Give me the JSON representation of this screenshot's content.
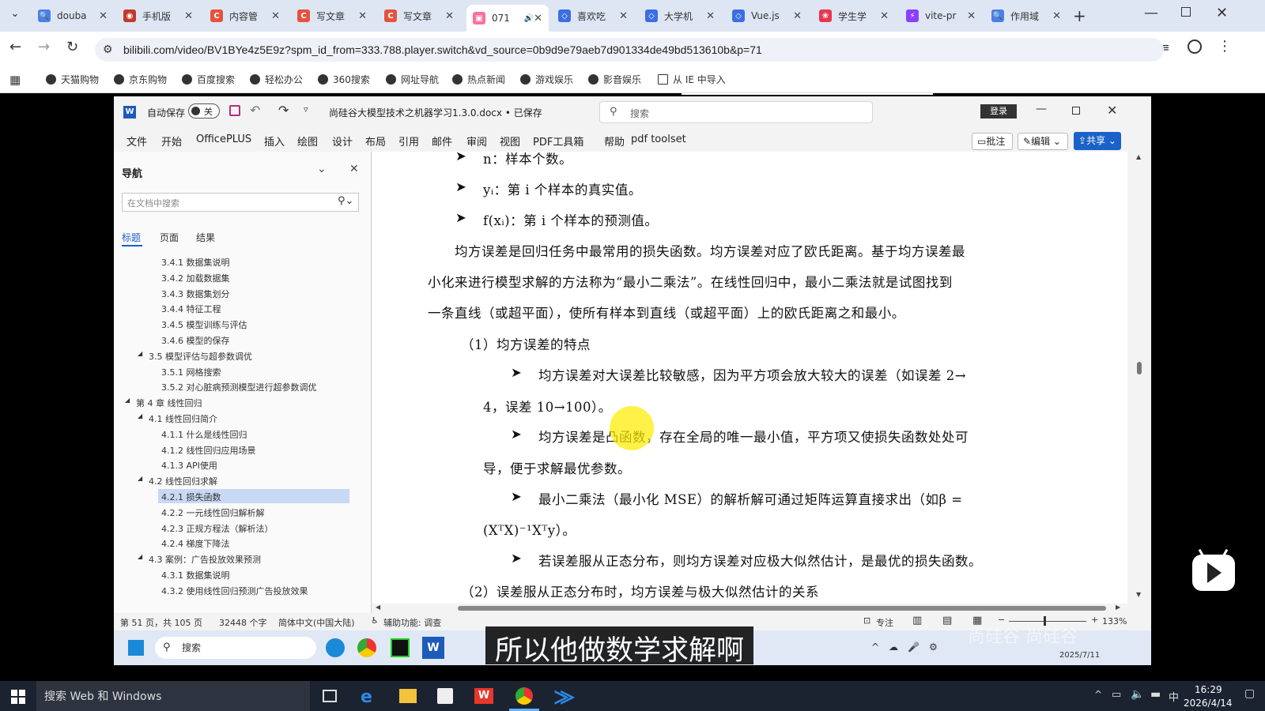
{
  "browser": {
    "tabs": [
      {
        "label": "douba",
        "color": "#4a7fe8",
        "glyph": "🔍",
        "icon": "search-icon"
      },
      {
        "label": "手机版",
        "color": "#c0392b",
        "glyph": "◉",
        "icon": "avatar-icon"
      },
      {
        "label": "内容管",
        "color": "#e5533d",
        "glyph": "C",
        "icon": "csdn-icon"
      },
      {
        "label": "写文章",
        "color": "#e5533d",
        "glyph": "C",
        "icon": "csdn-icon"
      },
      {
        "label": "写文章",
        "color": "#e5533d",
        "glyph": "C",
        "icon": "csdn-icon"
      },
      {
        "label": "071",
        "color": "#fb7299",
        "glyph": "▣",
        "icon": "bilibili-icon",
        "active": true
      },
      {
        "label": "喜欢吃",
        "color": "#3b6fe0",
        "glyph": "◇",
        "icon": "diamond-icon"
      },
      {
        "label": "大学机",
        "color": "#3b6fe0",
        "glyph": "◇",
        "icon": "diamond-icon"
      },
      {
        "label": "Vue.js",
        "color": "#3b6fe0",
        "glyph": "◇",
        "icon": "diamond-icon"
      },
      {
        "label": "学生学",
        "color": "#e63950",
        "glyph": "❀",
        "icon": "flower-icon"
      },
      {
        "label": "vite-pr",
        "color": "#8a3ffc",
        "glyph": "⚡",
        "icon": "vite-icon"
      },
      {
        "label": "作用域",
        "color": "#4a7fe8",
        "glyph": "🔍",
        "icon": "search-icon"
      }
    ],
    "url": "bilibili.com/video/BV1BYe4z5E9z?spm_id_from=333.788.player.switch&vd_source=0b9d9e79aeb7d901334de49bd513610b&p=71",
    "bookmarks": [
      "天猫购物",
      "京东购物",
      "百度搜索",
      "轻松办公",
      "360搜索",
      "网址导航",
      "热点新闻",
      "游戏娱乐",
      "影音娱乐",
      "从 IE 中导入"
    ]
  },
  "word": {
    "autosave_label": "自动保存",
    "autosave_state": "关",
    "doc_title": "尚硅谷大模型技术之机器学习1.3.0.docx • 已保存",
    "search_placeholder": "搜索",
    "login_label": "登录",
    "menu": [
      "文件",
      "开始",
      "OfficePLUS",
      "插入",
      "绘图",
      "设计",
      "布局",
      "引用",
      "邮件",
      "审阅",
      "视图",
      "PDF工具箱",
      "帮助",
      "pdf toolset"
    ],
    "comment_label": "批注",
    "edit_label": "编辑",
    "share_label": "共享",
    "nav": {
      "title": "导航",
      "search_placeholder": "在文档中搜索",
      "tabs": [
        "标题",
        "页面",
        "结果"
      ],
      "items": [
        {
          "text": "3.4.1 数据集说明",
          "level": 3
        },
        {
          "text": "3.4.2 加载数据集",
          "level": 3
        },
        {
          "text": "3.4.3 数据集划分",
          "level": 3
        },
        {
          "text": "3.4.4 特征工程",
          "level": 3
        },
        {
          "text": "3.4.5 模型训练与评估",
          "level": 3
        },
        {
          "text": "3.4.6 模型的保存",
          "level": 3
        },
        {
          "text": "3.5 模型评估与超参数调优",
          "level": 2
        },
        {
          "text": "3.5.1 网格搜索",
          "level": 3
        },
        {
          "text": "3.5.2 对心脏病预测模型进行超参数调优",
          "level": 3
        },
        {
          "text": "第 4 章 线性回归",
          "level": 1
        },
        {
          "text": "4.1 线性回归简介",
          "level": 2
        },
        {
          "text": "4.1.1 什么是线性回归",
          "level": 3
        },
        {
          "text": "4.1.2 线性回归应用场景",
          "level": 3
        },
        {
          "text": "4.1.3 API使用",
          "level": 3
        },
        {
          "text": "4.2 线性回归求解",
          "level": 2
        },
        {
          "text": "4.2.1 损失函数",
          "level": 3,
          "selected": true
        },
        {
          "text": "4.2.2 一元线性回归解析解",
          "level": 3
        },
        {
          "text": "4.2.3 正规方程法（解析法）",
          "level": 3
        },
        {
          "text": "4.2.4 梯度下降法",
          "level": 3
        },
        {
          "text": "4.3 案例：广告投放效果预测",
          "level": 2
        },
        {
          "text": "4.3.1 数据集说明",
          "level": 3
        },
        {
          "text": "4.3.2 使用线性回归预测广告投放效果",
          "level": 3
        }
      ]
    },
    "doc_lines": [
      "n：样本个数。",
      "yᵢ：第 i 个样本的真实值。",
      "f(xᵢ)：第 i 个样本的预测值。",
      "均方误差是回归任务中最常用的损失函数。均方误差对应了欧氏距离。基于均方误差最",
      "小化来进行模型求解的方法称为“最小二乘法”。在线性回归中，最小二乘法就是试图找到",
      "一条直线（或超平面），使所有样本到直线（或超平面）上的欧氏距离之和最小。",
      "（1）均方误差的特点",
      "均方误差对大误差比较敏感，因为平方项会放大较大的误差（如误差 2→",
      "4，误差 10→100）。",
      "均方误差是凸函数，存在全局的唯一最小值，平方项又使损失函数处处可",
      "导，便于求解最优参数。",
      "最小二乘法（最小化 MSE）的解析解可通过矩阵运算直接求出（如β =",
      "(XᵀX)⁻¹Xᵀy）。",
      "若误差服从正态分布，则均方误差对应极大似然估计，是最优的损失函数。",
      "（2）误差服从正态分布时，均方误差与极大似然估计的关系"
    ],
    "status": {
      "page": "第 51 页，共 105 页",
      "words": "32448 个字",
      "lang": "简体中文(中国大陆)",
      "accessibility": "辅助功能: 调查",
      "focus": "专注",
      "zoom": "133%"
    },
    "taskbar": {
      "search": "搜索",
      "date": "2025/7/11"
    }
  },
  "subtitle": "所以他做数学求解啊",
  "watermark": "尚硅谷 尚硅谷",
  "windows": {
    "search_placeholder": "搜索 Web 和 Windows",
    "time": "16:29",
    "date": "2026/4/14",
    "ime": "中"
  }
}
